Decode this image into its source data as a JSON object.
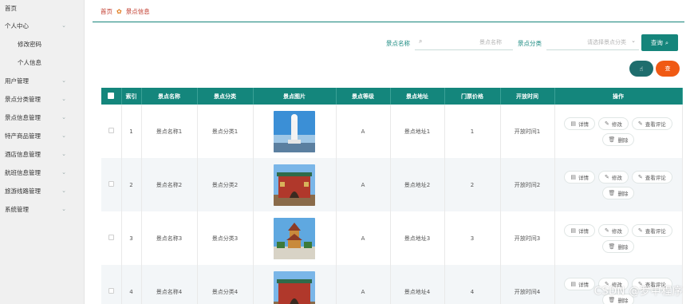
{
  "sidebar": {
    "items": [
      {
        "label": "首页",
        "chevron": false
      },
      {
        "label": "个人中心",
        "chevron": true
      },
      {
        "label": "修改密码",
        "sub": true
      },
      {
        "label": "个人信息",
        "sub": true
      },
      {
        "label": "用户管理",
        "chevron": true
      },
      {
        "label": "景点分类管理",
        "chevron": true
      },
      {
        "label": "景点信息管理",
        "chevron": true
      },
      {
        "label": "特产商品管理",
        "chevron": true
      },
      {
        "label": "酒店信息管理",
        "chevron": true
      },
      {
        "label": "航班信息管理",
        "chevron": true
      },
      {
        "label": "旅游线路管理",
        "chevron": true
      },
      {
        "label": "系统管理",
        "chevron": true
      }
    ]
  },
  "breadcrumb": {
    "home": "首页",
    "current": "景点信息"
  },
  "search": {
    "name_label": "景点名称",
    "name_placeholder": "景点名称",
    "category_label": "景点分类",
    "category_placeholder": "请选择景点分类",
    "button_label": "查询"
  },
  "actions": {
    "delete_label": "查"
  },
  "table": {
    "headers": [
      "索引",
      "景点名称",
      "景点分类",
      "景点图片",
      "景点等级",
      "景点地址",
      "门票价格",
      "开放时间",
      "操作"
    ],
    "rows": [
      {
        "index": "1",
        "name": "景点名称1",
        "category": "景点分类1",
        "level": "A",
        "address": "景点地址1",
        "price": "1",
        "open_time": "开放时间1"
      },
      {
        "index": "2",
        "name": "景点名称2",
        "category": "景点分类2",
        "level": "A",
        "address": "景点地址2",
        "price": "2",
        "open_time": "开放时间2"
      },
      {
        "index": "3",
        "name": "景点名称3",
        "category": "景点分类3",
        "level": "A",
        "address": "景点地址3",
        "price": "3",
        "open_time": "开放时间3"
      },
      {
        "index": "4",
        "name": "景点名称4",
        "category": "景点分类4",
        "level": "A",
        "address": "景点地址4",
        "price": "4",
        "open_time": "开放时间4"
      }
    ],
    "ops": {
      "detail": "详情",
      "edit": "修改",
      "review": "查看评论",
      "delete": "删除"
    }
  },
  "watermark": "CSDN @罗中程序",
  "colors": {
    "primary": "#14867c",
    "danger": "#f05a14",
    "breadcrumb": "#c0392b"
  }
}
